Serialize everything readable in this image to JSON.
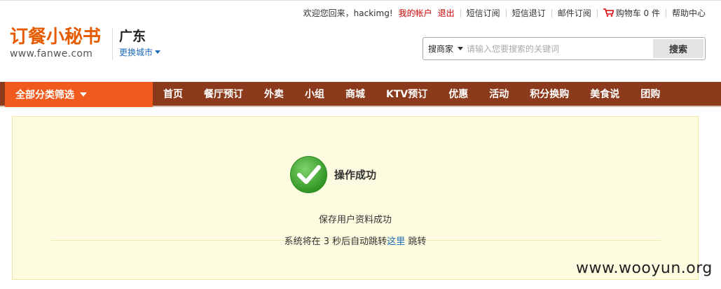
{
  "topbar": {
    "welcome": "欢迎您回来，hackimg!",
    "my_account": "我的帐户",
    "logout": "退出",
    "sms_subscribe": "短信订阅",
    "sms_unsubscribe": "短信退订",
    "email_subscribe": "邮件订阅",
    "cart": "购物车 0 件",
    "help": "帮助中心"
  },
  "logo": {
    "title": "订餐小秘书",
    "url": "www.fanwe.com"
  },
  "city": {
    "name": "广东",
    "switch_label": "更换城市"
  },
  "search": {
    "type_label": "搜商家",
    "placeholder": "请输入您要搜索的关键词",
    "button_label": "搜索"
  },
  "nav": {
    "all_categories": "全部分类筛选",
    "items": [
      "首页",
      "餐厅预订",
      "外卖",
      "小组",
      "商城",
      "KTV预订",
      "优惠",
      "活动",
      "积分换购",
      "美食说",
      "团购"
    ]
  },
  "result": {
    "title": "操作成功",
    "message": "保存用户资料成功",
    "redirect_prefix": "系统将在 3 秒后自动跳转",
    "redirect_link": "这里",
    "redirect_suffix": " 跳转"
  },
  "watermark": "www.wooyun.org",
  "colors": {
    "brand_orange": "#e55b00",
    "nav_brown": "#8b3b1c",
    "nav_active_orange": "#f05a1c",
    "success_green": "#3aa12c",
    "panel_bg": "#fdfbe0",
    "link_blue": "#1c6bb8"
  }
}
